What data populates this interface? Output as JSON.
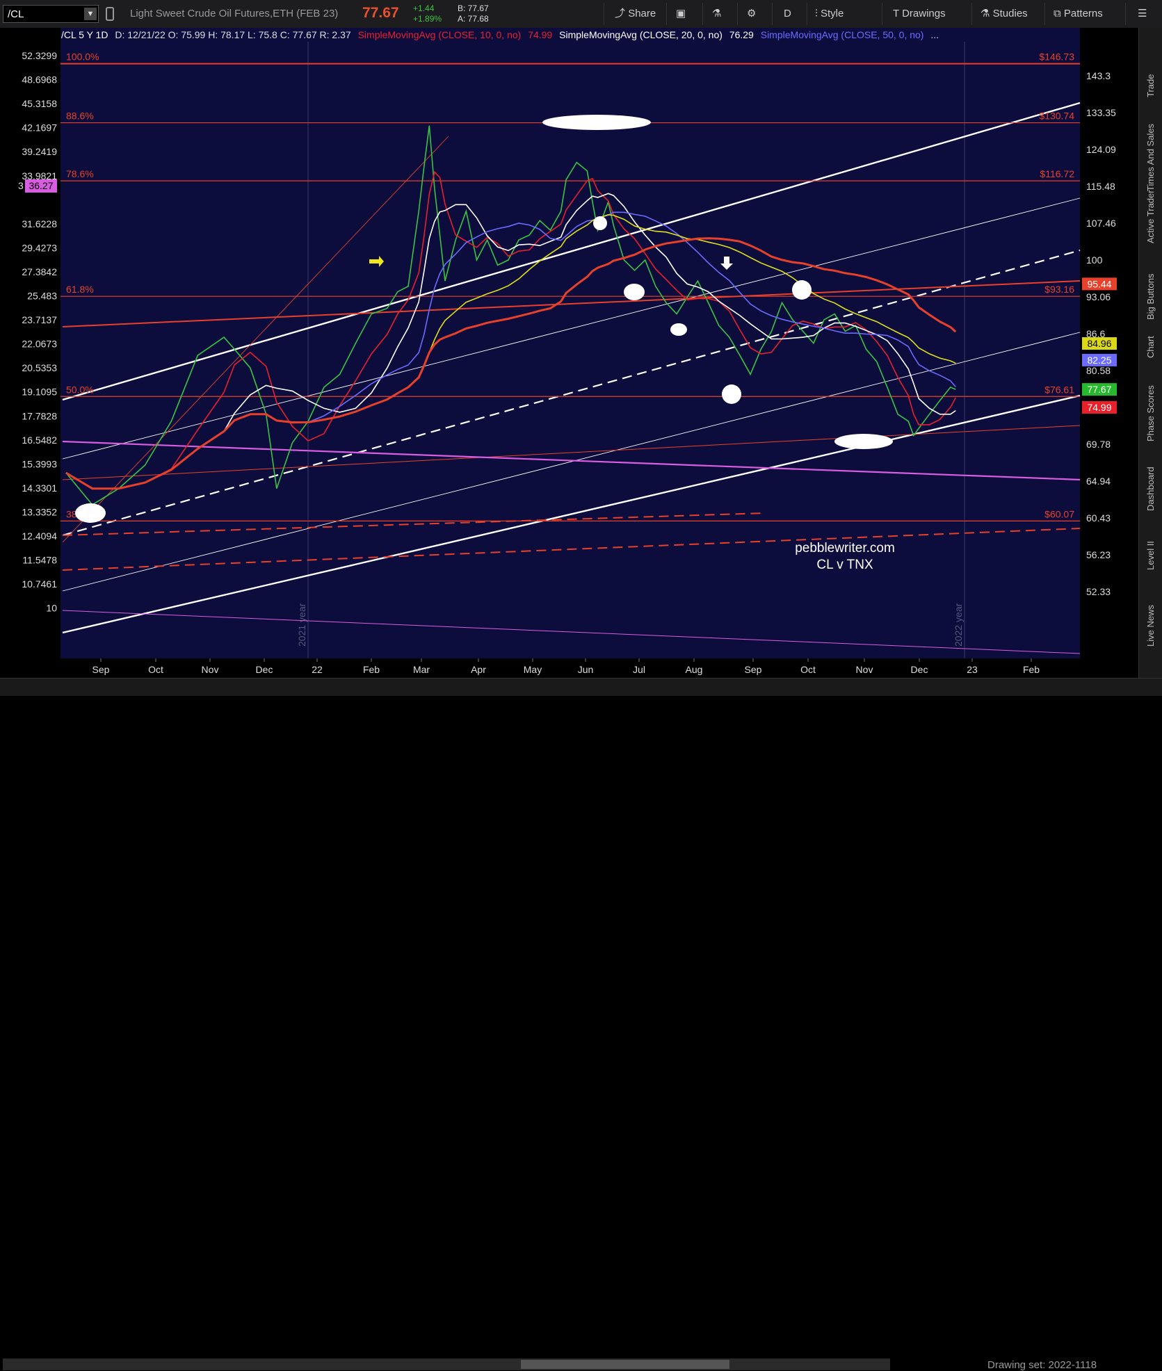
{
  "toolbar": {
    "symbol": "/CL",
    "description": "Light Sweet Crude Oil Futures,ETH (FEB 23)",
    "last": "77.67",
    "change": "+1.44",
    "change_pct": "+1.89%",
    "bid": "B: 77.67",
    "ask": "A: 77.68",
    "share": "Share",
    "period": "D",
    "style": "Style",
    "drawings": "Drawings",
    "studies": "Studies",
    "patterns": "Patterns"
  },
  "legend": {
    "symbol_info": "/CL 5 Y 1D",
    "ohlc": "D: 12/21/22  O: 75.99  H: 78.17  L: 75.8  C: 77.67  R: 2.37",
    "sma10": "SimpleMovingAvg (CLOSE, 10, 0, no)",
    "sma10_val": "74.99",
    "sma20": "SimpleMovingAvg (CLOSE, 20, 0, no)",
    "sma20_val": "76.29",
    "sma50": "SimpleMovingAvg (CLOSE, 50, 0, no)",
    "more": "..."
  },
  "side_tabs": [
    "Trade",
    "Times And Sales",
    "Active Trader",
    "Big Buttons",
    "Chart",
    "Phase Scores",
    "Dashboard",
    "Level II",
    "Live News"
  ],
  "status": {
    "drawing_set": "Drawing set: 2022-1118"
  },
  "annotation": {
    "site": "pebblewriter.com",
    "subtitle": "CL v TNX"
  },
  "chart_data": {
    "type": "line",
    "left_axis_ticks": [
      "52.3299",
      "48.6968",
      "45.3158",
      "42.1697",
      "39.2419",
      "33.9821",
      "31.6228",
      "29.4273",
      "27.3842",
      "25.483",
      "23.7137",
      "22.0673",
      "20.5353",
      "19.1095",
      "17.7828",
      "16.5482",
      "15.3993",
      "14.3301",
      "13.3352",
      "12.4094",
      "11.5478",
      "10.7461",
      "10"
    ],
    "left_partial_label": "3",
    "left_marker": "36.27",
    "right_axis_ticks": [
      "143.3",
      "133.35",
      "124.09",
      "115.48",
      "107.46",
      "100",
      "93.06",
      "86.6",
      "80.58",
      "69.78",
      "64.94",
      "60.43",
      "56.23",
      "52.33"
    ],
    "right_markers": [
      {
        "value": "95.44",
        "color": "#e8402a"
      },
      {
        "value": "84.96",
        "color": "#d9d91a"
      },
      {
        "value": "82.25",
        "color": "#6b6bff"
      },
      {
        "value": "77.67",
        "color": "#27b82e"
      },
      {
        "value": "74.99",
        "color": "#e8202a"
      }
    ],
    "x_ticks": [
      "Sep",
      "Oct",
      "Nov",
      "Dec",
      "22",
      "Feb",
      "Mar",
      "Apr",
      "May",
      "Jun",
      "Jul",
      "Aug",
      "Sep",
      "Oct",
      "Nov",
      "Dec",
      "23",
      "Feb"
    ],
    "year_markers": [
      "2021 year",
      "2022 year"
    ],
    "fib_levels": [
      {
        "pct": "100.0%",
        "price": "$146.73",
        "value": 146.73
      },
      {
        "pct": "88.6%",
        "price": "$130.74",
        "value": 130.74
      },
      {
        "pct": "78.6%",
        "price": "$116.72",
        "value": 116.72
      },
      {
        "pct": "61.8%",
        "price": "$93.16",
        "value": 93.16
      },
      {
        "pct": "50.0%",
        "price": "$76.61",
        "value": 76.61
      },
      {
        "pct": "38.2%",
        "price": "$60.07",
        "value": 60.07
      }
    ],
    "price_path_cl": [
      [
        0,
        66
      ],
      [
        5,
        62
      ],
      [
        10,
        64
      ],
      [
        15,
        67
      ],
      [
        20,
        73
      ],
      [
        25,
        83
      ],
      [
        30,
        86
      ],
      [
        32,
        84
      ],
      [
        35,
        81
      ],
      [
        38,
        74
      ],
      [
        40,
        64
      ],
      [
        43,
        70
      ],
      [
        46,
        73
      ],
      [
        49,
        78
      ],
      [
        52,
        80
      ],
      [
        55,
        85
      ],
      [
        58,
        90
      ],
      [
        61,
        91
      ],
      [
        63,
        94
      ],
      [
        65,
        95
      ],
      [
        67,
        110
      ],
      [
        68,
        120
      ],
      [
        69,
        130
      ],
      [
        70,
        115
      ],
      [
        71,
        105
      ],
      [
        72,
        96
      ],
      [
        74,
        104
      ],
      [
        76,
        110
      ],
      [
        78,
        100
      ],
      [
        80,
        104
      ],
      [
        82,
        99
      ],
      [
        84,
        100
      ],
      [
        86,
        104
      ],
      [
        88,
        105
      ],
      [
        90,
        108
      ],
      [
        92,
        106
      ],
      [
        94,
        110
      ],
      [
        95,
        117
      ],
      [
        97,
        121
      ],
      [
        99,
        119
      ],
      [
        100,
        112
      ],
      [
        101,
        106
      ],
      [
        103,
        112
      ],
      [
        104,
        107
      ],
      [
        106,
        100
      ],
      [
        108,
        98
      ],
      [
        110,
        100
      ],
      [
        112,
        95
      ],
      [
        114,
        92
      ],
      [
        116,
        90
      ],
      [
        118,
        93
      ],
      [
        120,
        96
      ],
      [
        122,
        92
      ],
      [
        124,
        88
      ],
      [
        126,
        86
      ],
      [
        128,
        83
      ],
      [
        130,
        80
      ],
      [
        132,
        84
      ],
      [
        134,
        87
      ],
      [
        136,
        92
      ],
      [
        138,
        89
      ],
      [
        140,
        87
      ],
      [
        142,
        85
      ],
      [
        144,
        89
      ],
      [
        146,
        90
      ],
      [
        148,
        87
      ],
      [
        150,
        88
      ],
      [
        152,
        84
      ],
      [
        154,
        82
      ],
      [
        156,
        78
      ],
      [
        158,
        74
      ],
      [
        160,
        73
      ],
      [
        161,
        71
      ],
      [
        162,
        72
      ],
      [
        164,
        74
      ],
      [
        166,
        76
      ],
      [
        168,
        78
      ],
      [
        169,
        77.67
      ]
    ],
    "series": [
      {
        "name": "SimpleMovingAvg (CLOSE, 10, 0, no)",
        "color": "#e8202a"
      },
      {
        "name": "SimpleMovingAvg (CLOSE, 20, 0, no)",
        "color": "#ffffff"
      },
      {
        "name": "SimpleMovingAvg (CLOSE, 50, 0, no)",
        "color": "#6b6bff"
      }
    ]
  }
}
